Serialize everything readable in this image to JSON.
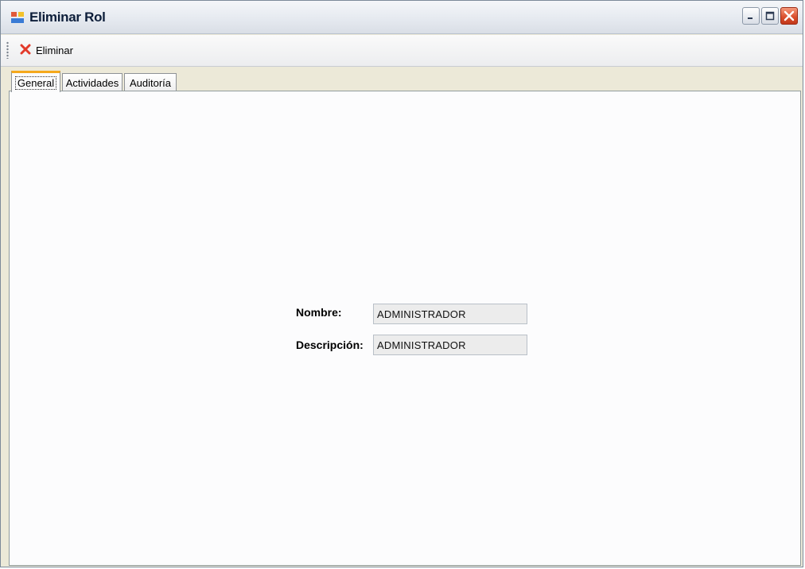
{
  "window": {
    "title": "Eliminar Rol"
  },
  "toolbar": {
    "delete_label": "Eliminar"
  },
  "tabs": [
    {
      "label": "General",
      "active": true
    },
    {
      "label": "Actividades",
      "active": false
    },
    {
      "label": "Auditoría",
      "active": false
    }
  ],
  "form": {
    "nombre_label": "Nombre:",
    "nombre_value": "ADMINISTRADOR",
    "descripcion_label": "Descripción:",
    "descripcion_value": "ADMINISTRADOR"
  },
  "icons": {
    "app": "window-app-icon",
    "delete": "red-x-icon"
  },
  "colors": {
    "active_tab_accent": "#f5a81c",
    "close_button": "#d94c2a",
    "field_bg": "#ececec"
  }
}
